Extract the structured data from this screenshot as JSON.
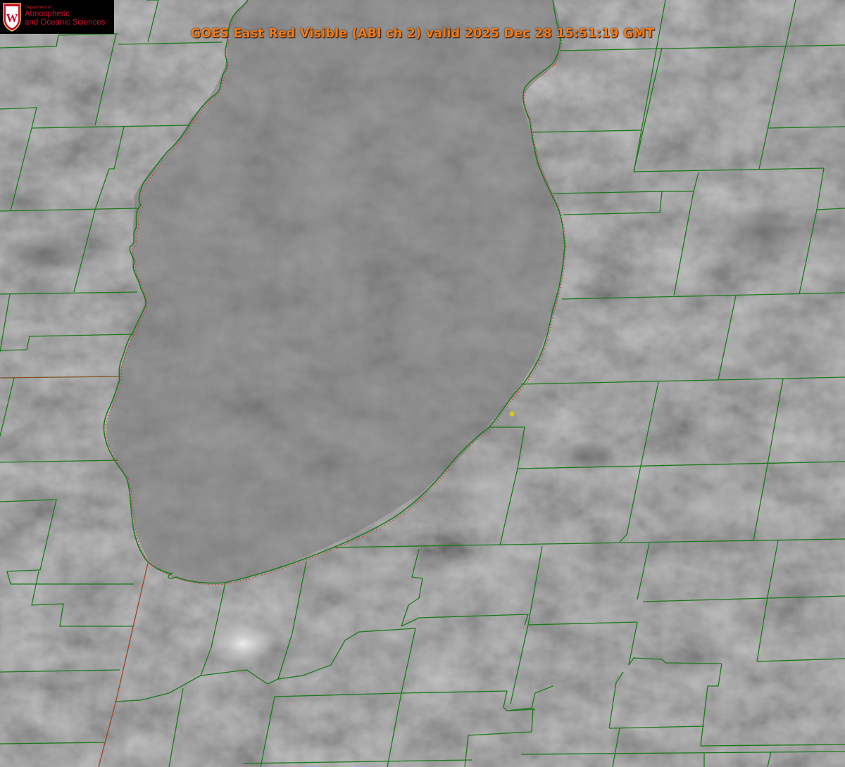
{
  "title": "GOES East Red Visible (ABI ch 2) valid 2025 Dec 28 15:51:19 GMT",
  "logo": {
    "dept": "Department of",
    "line1": "Atmospheric",
    "line2": "and Oceanic Sciences",
    "crest_letter": "W"
  },
  "colors": {
    "county_borders": "#1a7a1a",
    "state_border": "#c0392b",
    "shoreline_dotted": "#e03030",
    "marker": "#d8c820",
    "title": "#f07a18",
    "logo_red": "#c8102e"
  },
  "layers": [
    "visible-satellite-imagery",
    "county-borders",
    "state-border",
    "lake-shoreline",
    "location-marker"
  ]
}
